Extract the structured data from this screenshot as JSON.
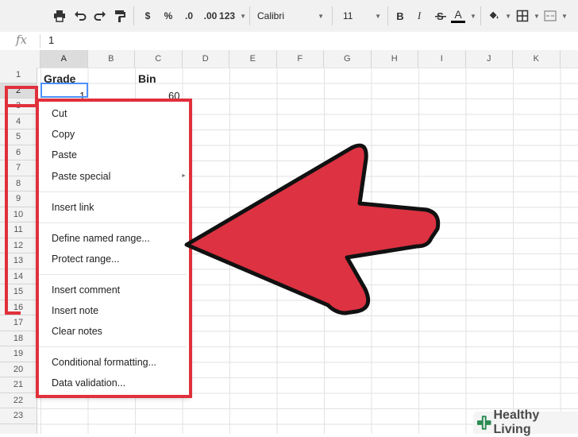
{
  "toolbar": {
    "number_format": "123",
    "currency": "$",
    "percent": "%",
    "dec_decrease": ".0",
    "dec_increase": ".00",
    "font_name": "Calibri",
    "font_size": "11",
    "bold": "B",
    "italic": "I",
    "text_color": "A",
    "text_color_swatch": "#000000"
  },
  "formula_bar": {
    "fx": "fx",
    "value": "1"
  },
  "columns": [
    "A",
    "B",
    "C",
    "D",
    "E",
    "F",
    "G",
    "H",
    "I",
    "J",
    "K"
  ],
  "rows": [
    "1",
    "2",
    "3",
    "4",
    "5",
    "6",
    "7",
    "8",
    "9",
    "10",
    "11",
    "12",
    "13",
    "14",
    "15",
    "16",
    "17",
    "18",
    "19",
    "20",
    "21",
    "22",
    "23"
  ],
  "cells": {
    "A1": "Grade",
    "C1": "Bin",
    "A2": "1",
    "C2": "60"
  },
  "context_menu": {
    "cut": "Cut",
    "copy": "Copy",
    "paste": "Paste",
    "paste_special": "Paste special",
    "insert_link": "Insert link",
    "define_named_range": "Define named range...",
    "protect_range": "Protect range...",
    "insert_comment": "Insert comment",
    "insert_note": "Insert note",
    "clear_notes": "Clear notes",
    "conditional_formatting": "Conditional formatting...",
    "data_validation": "Data validation..."
  },
  "colors": {
    "highlight_red": "#e0303b",
    "arrow_red": "#dc3241"
  },
  "watermark": {
    "text": "Healthy Living"
  }
}
